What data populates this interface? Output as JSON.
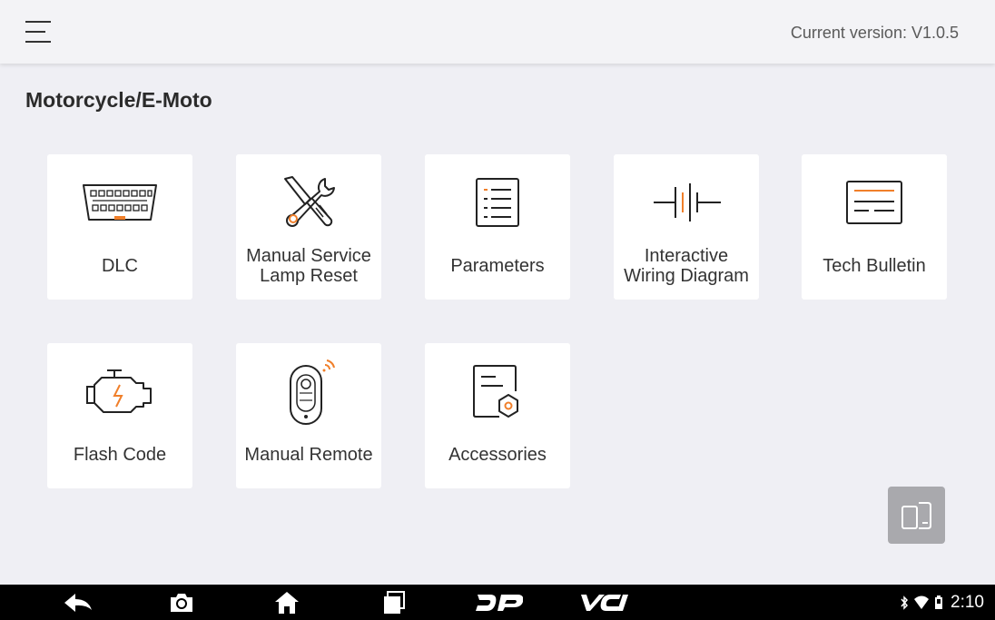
{
  "header": {
    "menu_icon": "hamburger-menu-icon",
    "version_text": "Current version: V1.0.5"
  },
  "section": {
    "title": "Motorcycle/E-Moto"
  },
  "tiles": [
    {
      "label": "DLC",
      "icon": "obd-connector-icon"
    },
    {
      "label": "Manual Service Lamp Reset",
      "icon": "wrench-screwdriver-icon"
    },
    {
      "label": "Parameters",
      "icon": "list-document-icon"
    },
    {
      "label": "Interactive Wiring Diagram",
      "icon": "battery-circuit-icon"
    },
    {
      "label": "Tech Bulletin",
      "icon": "bulletin-icon"
    },
    {
      "label": "Flash Code",
      "icon": "engine-icon"
    },
    {
      "label": "Manual Remote",
      "icon": "car-key-remote-icon"
    },
    {
      "label": "Accessories",
      "icon": "document-settings-icon"
    }
  ],
  "float_button": {
    "icon": "device-switch-icon"
  },
  "navbar": {
    "buttons": [
      {
        "name": "back",
        "icon": "back-arrow-icon"
      },
      {
        "name": "screenshot",
        "icon": "camera-icon"
      },
      {
        "name": "home",
        "icon": "home-icon"
      },
      {
        "name": "recents",
        "icon": "recent-apps-icon"
      },
      {
        "name": "dp",
        "icon": "dp-logo-icon"
      },
      {
        "name": "vci",
        "icon": "vci-logo-icon"
      }
    ],
    "status": {
      "time": "2:10"
    }
  },
  "colors": {
    "accent": "#f07f2a",
    "icon_stroke": "#222222",
    "background": "#efeff4",
    "tile": "#ffffff"
  }
}
